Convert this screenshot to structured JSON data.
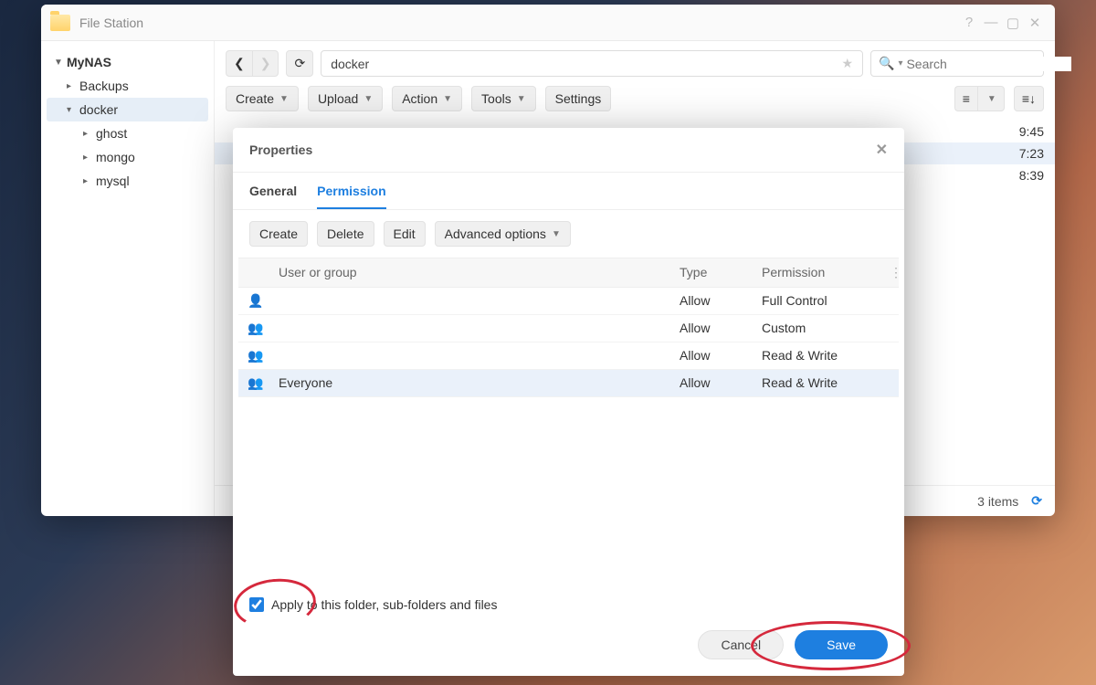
{
  "window": {
    "title": "File Station"
  },
  "sidebar": {
    "root": "MyNAS",
    "items": [
      "Backups",
      "docker",
      "ghost",
      "mongo",
      "mysql"
    ]
  },
  "nav": {
    "path": "docker",
    "search_placeholder": "Search"
  },
  "toolbar": {
    "create": "Create",
    "upload": "Upload",
    "action": "Action",
    "tools": "Tools",
    "settings": "Settings"
  },
  "filerows": {
    "times": [
      "9:45",
      "7:23",
      "8:39"
    ]
  },
  "status": {
    "count": "3 items"
  },
  "dialog": {
    "title": "Properties",
    "tabs": {
      "general": "General",
      "permission": "Permission"
    },
    "buttons": {
      "create": "Create",
      "delete": "Delete",
      "edit": "Edit",
      "advanced": "Advanced options"
    },
    "columns": {
      "user": "User or group",
      "type": "Type",
      "perm": "Permission"
    },
    "rows": [
      {
        "icon": "user",
        "name": "",
        "type": "Allow",
        "perm": "Full Control"
      },
      {
        "icon": "group",
        "name": "",
        "type": "Allow",
        "perm": "Custom"
      },
      {
        "icon": "group",
        "name": "",
        "type": "Allow",
        "perm": "Read & Write"
      },
      {
        "icon": "group",
        "name": "Everyone",
        "type": "Allow",
        "perm": "Read & Write"
      }
    ],
    "apply_label": "Apply to this folder, sub-folders and files",
    "cancel": "Cancel",
    "save": "Save"
  }
}
